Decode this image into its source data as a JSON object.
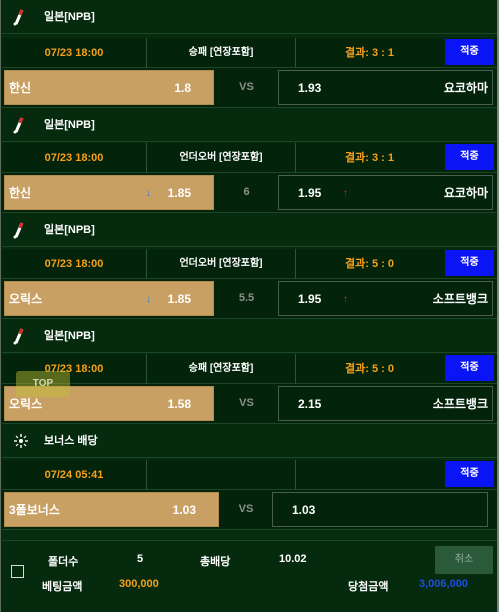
{
  "bets": [
    {
      "league_icon": "baseball-icon",
      "league": "일본[NPB]",
      "date": "07/23 18:00",
      "type": "승패 [연장포함]",
      "result": "결과: 3 : 1",
      "hit": "적중",
      "home": "한신",
      "home_odd": "1.8",
      "home_arrow": "",
      "mid": "VS",
      "away_odd": "1.93",
      "away_arrow": "",
      "away": "요코하마"
    },
    {
      "league_icon": "baseball-icon",
      "league": "일본[NPB]",
      "date": "07/23 18:00",
      "type": "언더오버 [연장포함]",
      "result": "결과: 3 : 1",
      "hit": "적중",
      "home": "한신",
      "home_odd": "1.85",
      "home_arrow": "↓",
      "mid": "6",
      "away_odd": "1.95",
      "away_arrow": "↑",
      "away": "요코하마"
    },
    {
      "league_icon": "baseball-icon",
      "league": "일본[NPB]",
      "date": "07/23 18:00",
      "type": "언더오버 [연장포함]",
      "result": "결과: 5 : 0",
      "hit": "적중",
      "home": "오릭스",
      "home_odd": "1.85",
      "home_arrow": "↓",
      "mid": "5.5",
      "away_odd": "1.95",
      "away_arrow": "↑",
      "away": "소프트뱅크"
    },
    {
      "league_icon": "baseball-icon",
      "league": "일본[NPB]",
      "date": "07/23 18:00",
      "type": "승패 [연장포함]",
      "result": "결과: 5 : 0",
      "hit": "적중",
      "home": "오릭스",
      "home_odd": "1.58",
      "home_arrow": "",
      "mid": "VS",
      "away_odd": "2.15",
      "away_arrow": "",
      "away": "소프트뱅크"
    },
    {
      "league_icon": "bonus-sparkle-icon",
      "league": "보너스 배당",
      "date": "07/24 05:41",
      "type": "",
      "result": "",
      "hit": "적중",
      "home": "3폴보너스",
      "home_odd": "1.03",
      "home_arrow": "",
      "mid": "VS",
      "away_odd": "1.03",
      "away_arrow": "",
      "away": ""
    }
  ],
  "top_button": "TOP",
  "summary": {
    "folders_label": "폴더수",
    "folders_value": "5",
    "total_odds_label": "총배당",
    "total_odds_value": "10.02",
    "bet_amount_label": "베팅금액",
    "bet_amount_value": "300,000",
    "win_amount_label": "당첨금액",
    "win_amount_value": "3,006,000",
    "cancel_label": "취소"
  },
  "colors": {
    "background": "#062c10",
    "home_cell": "#c9a063",
    "date_text": "#f6a01a",
    "hit_badge": "#0a14f4",
    "win_amount": "#1d4fe0",
    "bet_amount": "#f6a01a"
  }
}
